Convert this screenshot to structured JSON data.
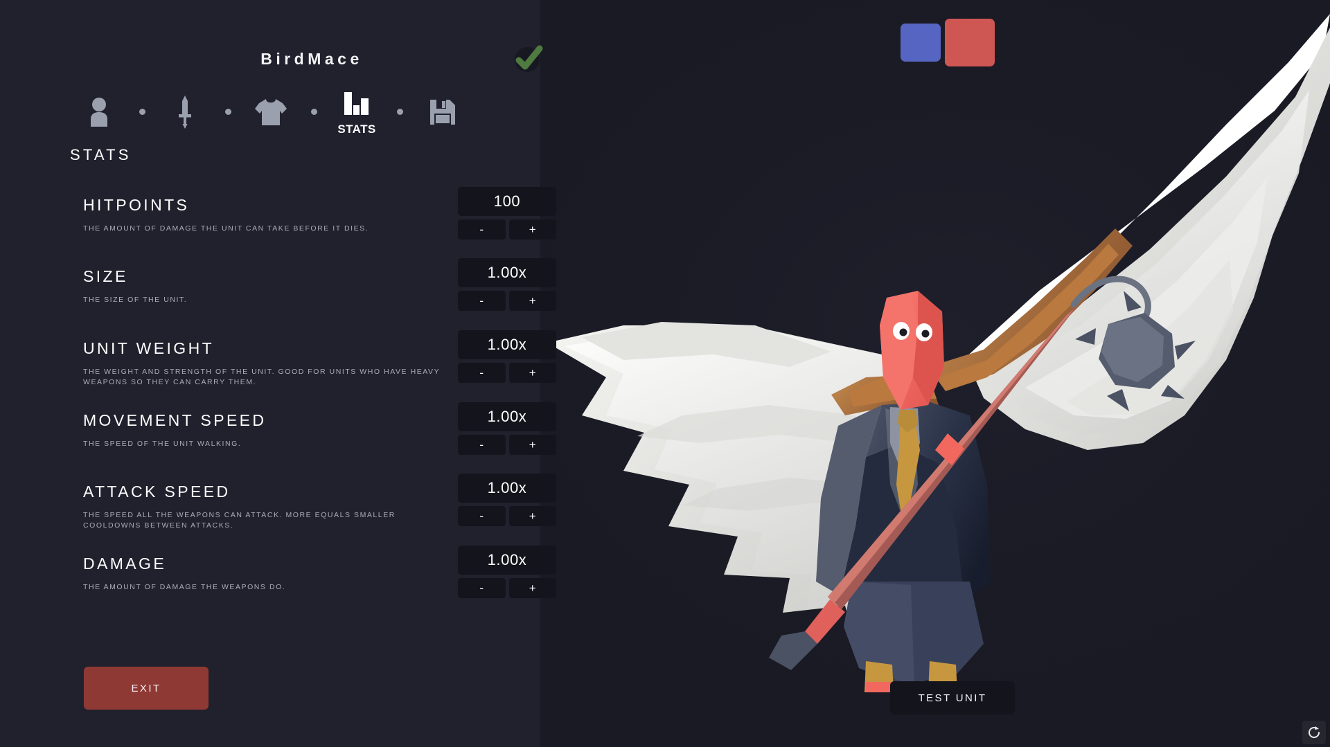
{
  "window": {
    "background_color": "#21212e",
    "panel_color": "#14141c"
  },
  "header": {
    "unit_name": "BirdMace",
    "confirm_icon": "check-icon",
    "confirm_color": "#4f7a40"
  },
  "team_colors": {
    "blue": "#5665c2",
    "red": "#cf5753",
    "selected": "red"
  },
  "nav": {
    "items": [
      {
        "icon": "person-icon",
        "label": "",
        "active": false
      },
      {
        "icon": "sword-icon",
        "label": "",
        "active": false
      },
      {
        "icon": "tshirt-icon",
        "label": "",
        "active": false
      },
      {
        "icon": "bar-chart-icon",
        "label": "STATS",
        "active": true
      },
      {
        "icon": "floppy-disk-icon",
        "label": "",
        "active": false
      }
    ],
    "separator_icon": "dot-icon",
    "inactive_color": "#9ba0ae",
    "active_color": "#ffffff"
  },
  "panel": {
    "title": "STATS"
  },
  "stats": [
    {
      "name": "HITPOINTS",
      "description": "THE AMOUNT OF DAMAGE THE UNIT CAN TAKE BEFORE IT DIES.",
      "value": "100",
      "decrement_label": "-",
      "increment_label": "+"
    },
    {
      "name": "SIZE",
      "description": "THE SIZE OF THE UNIT.",
      "value": "1.00x",
      "decrement_label": "-",
      "increment_label": "+"
    },
    {
      "name": "UNIT WEIGHT",
      "description": "THE WEIGHT AND STRENGTH OF THE UNIT. GOOD FOR UNITS WHO HAVE HEAVY WEAPONS SO THEY CAN CARRY THEM.",
      "value": "1.00x",
      "decrement_label": "-",
      "increment_label": "+"
    },
    {
      "name": "MOVEMENT SPEED",
      "description": "THE SPEED OF THE UNIT WALKING.",
      "value": "1.00x",
      "decrement_label": "-",
      "increment_label": "+"
    },
    {
      "name": "ATTACK SPEED",
      "description": "THE SPEED ALL THE WEAPONS CAN ATTACK. MORE EQUALS SMALLER COOLDOWNS BETWEEN ATTACKS.",
      "value": "1.00x",
      "decrement_label": "-",
      "increment_label": "+"
    },
    {
      "name": "DAMAGE",
      "description": "THE AMOUNT OF DAMAGE THE WEAPONS DO.",
      "value": "1.00x",
      "decrement_label": "-",
      "increment_label": "+"
    }
  ],
  "footer": {
    "exit_label": "EXIT",
    "exit_color": "#8f3935",
    "test_unit_label": "TEST UNIT",
    "refresh_icon": "refresh-icon"
  },
  "preview": {
    "unit_icon": "winged-unit-with-mace",
    "skin_color": "#f2685e",
    "suit_color": "#2b3348",
    "wing_color": "#e9e9e6",
    "tie_color": "#c79740",
    "mace_handle_color": "#a85c57"
  }
}
